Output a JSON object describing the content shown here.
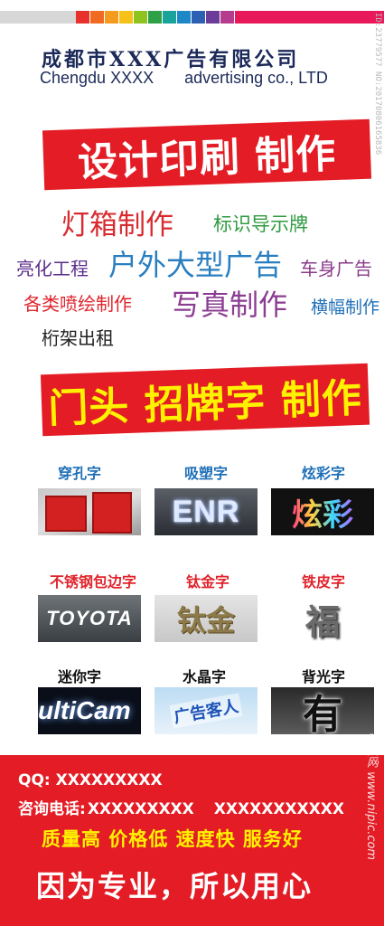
{
  "header": {
    "company_cn": "成都市XXX广告有限公司",
    "company_en_part1": "Chengdu XXXX",
    "company_en_part2": "advertising co., LTD",
    "image_id": "ID:23779577 NO:20170806165836"
  },
  "colors": {
    "banner_red": "#e31c25",
    "slogan_yellow": "#fff200",
    "stripe": [
      "#e8312b",
      "#f06a22",
      "#f39a1f",
      "#f6c21a",
      "#8fc31f",
      "#2ea048",
      "#1aa39a",
      "#1e88c7",
      "#2d5fb3",
      "#6b3c98",
      "#b53c8e",
      "#e8195a"
    ]
  },
  "banner1": "设计印刷 制作",
  "services": [
    "灯箱制作",
    "标识导示牌",
    "亮化工程",
    "户外大型广告",
    "车身广告",
    "各类喷绘制作",
    "写真制作",
    "横幅制作",
    "桁架出租"
  ],
  "banner2": "门头 招牌字 制作",
  "products": [
    {
      "title": "穿孔字",
      "photo_text": ""
    },
    {
      "title": "吸塑字",
      "photo_text": "ENR"
    },
    {
      "title": "炫彩字",
      "photo_text": "炫彩"
    },
    {
      "title": "不锈钢包边字",
      "photo_text": "TOYOTA"
    },
    {
      "title": "钛金字",
      "photo_text": "钛金"
    },
    {
      "title": "铁皮字",
      "photo_text": "福"
    },
    {
      "title": "迷你字",
      "photo_text": "ultiCam"
    },
    {
      "title": "水晶字",
      "photo_text": "广告客人"
    },
    {
      "title": "背光字",
      "photo_text": "有"
    }
  ],
  "contact": {
    "qq": "QQ: XXXXXXXXX",
    "phone_label": "咨询电话:",
    "phone1": "XXXXXXXXX",
    "phone2": "XXXXXXXXXXX"
  },
  "slogan": "质量高 价格低 速度快 服务好",
  "tagline": "因为专业，所以用心",
  "watermark": "昵图网 www.nipic.com"
}
